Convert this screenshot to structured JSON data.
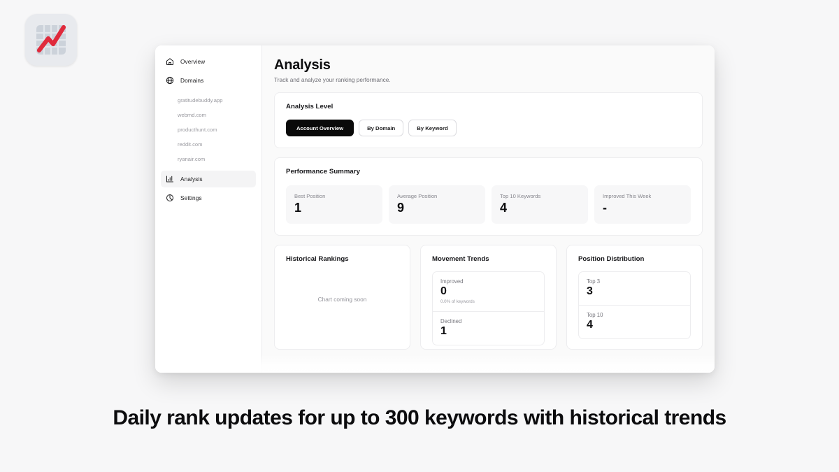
{
  "app_icon": {
    "name": "rank-tracker-app-icon",
    "accent_color": "#e02a3c",
    "bg_color": "#e8eaee"
  },
  "sidebar": {
    "items": [
      {
        "label": "Overview",
        "icon": "home-icon",
        "active": false
      },
      {
        "label": "Domains",
        "icon": "globe-icon",
        "active": false
      },
      {
        "label": "Analysis",
        "icon": "bar-chart-icon",
        "active": true
      },
      {
        "label": "Settings",
        "icon": "gear-icon",
        "active": false
      }
    ],
    "domains": [
      "gratitudebuddy.app",
      "webmd.com",
      "producthunt.com",
      "reddit.com",
      "ryanair.com"
    ]
  },
  "header": {
    "title": "Analysis",
    "subtitle": "Track and analyze your ranking performance."
  },
  "analysis_level": {
    "title": "Analysis Level",
    "options": [
      {
        "label": "Account Overview",
        "selected": true
      },
      {
        "label": "By Domain",
        "selected": false
      },
      {
        "label": "By Keyword",
        "selected": false
      }
    ]
  },
  "performance_summary": {
    "title": "Performance Summary",
    "stats": [
      {
        "label": "Best Position",
        "value": "1"
      },
      {
        "label": "Average Position",
        "value": "9"
      },
      {
        "label": "Top 10 Keywords",
        "value": "4"
      },
      {
        "label": "Improved This Week",
        "value": "-"
      }
    ]
  },
  "historical_rankings": {
    "title": "Historical Rankings",
    "placeholder": "Chart coming soon"
  },
  "movement_trends": {
    "title": "Movement Trends",
    "metrics": [
      {
        "label": "Improved",
        "value": "0",
        "sub": "0.0% of keywords"
      },
      {
        "label": "Declined",
        "value": "1",
        "sub": ""
      }
    ]
  },
  "position_distribution": {
    "title": "Position Distribution",
    "metrics": [
      {
        "label": "Top 3",
        "value": "3",
        "sub": ""
      },
      {
        "label": "Top 10",
        "value": "4",
        "sub": ""
      }
    ]
  },
  "caption": {
    "text": "Daily rank updates for up to 300 keywords with historical trends"
  }
}
